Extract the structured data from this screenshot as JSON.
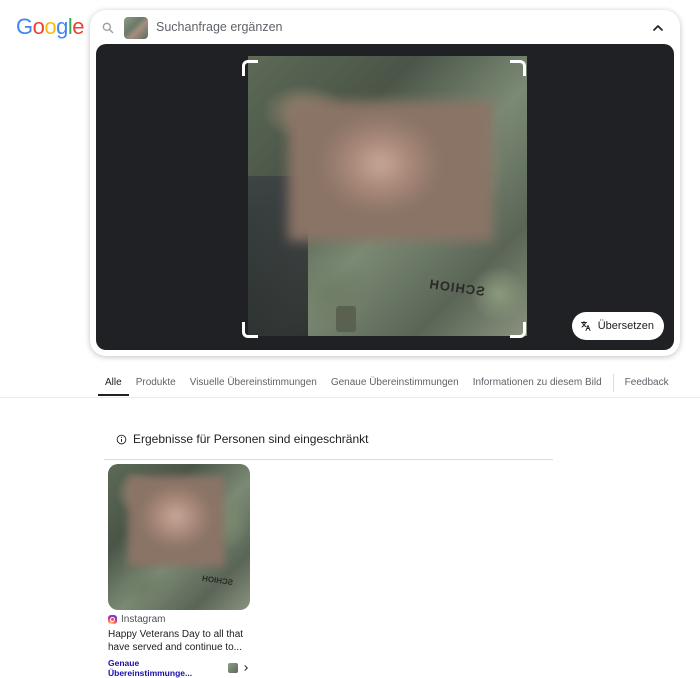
{
  "logo": {
    "letters": [
      "G",
      "o",
      "o",
      "g",
      "l",
      "e"
    ],
    "colors": [
      "#4285F4",
      "#EA4335",
      "#FBBC05",
      "#4285F4",
      "#34A853",
      "#EA4335"
    ]
  },
  "search": {
    "query_placeholder": "Suchanfrage ergänzen",
    "icons": [
      "search-icon",
      "chevron-up-icon"
    ]
  },
  "viewer": {
    "patch_text": "SCHIOH",
    "translate_label": "Übersetzen",
    "icons": [
      "translate-icon"
    ]
  },
  "tabs": [
    {
      "label": "Alle",
      "active": true
    },
    {
      "label": "Produkte",
      "active": false
    },
    {
      "label": "Visuelle Übereinstimmungen",
      "active": false
    },
    {
      "label": "Genaue Übereinstimmungen",
      "active": false
    },
    {
      "label": "Informationen zu diesem Bild",
      "active": false
    },
    {
      "label": "Feedback",
      "active": false
    }
  ],
  "notice": {
    "text": "Ergebnisse für Personen sind eingeschränkt",
    "icon": "info-icon"
  },
  "result": {
    "source": "Instagram",
    "title": "Happy Veterans Day to all that have served and continue to...",
    "match_label": "Genaue Übereinstimmunge...",
    "patch_text": "SCHIOH"
  }
}
